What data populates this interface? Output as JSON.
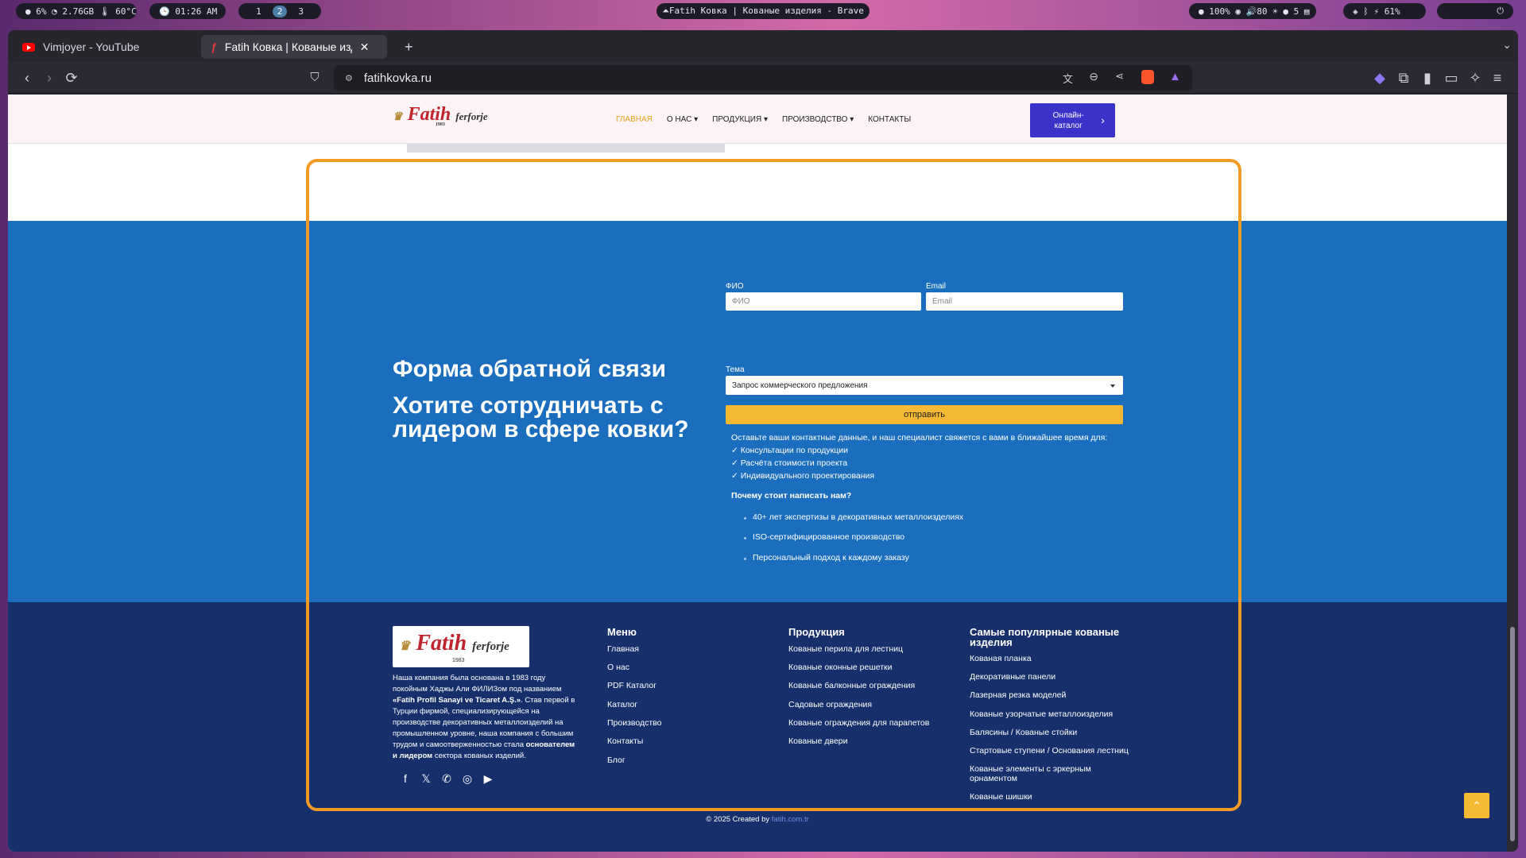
{
  "system_bar": {
    "stats": "● 6%  ◔ 2.76GB  🌡 60°C",
    "clock": "🕒  01:26 AM",
    "workspaces": [
      "1",
      "2",
      "3"
    ],
    "active_workspace": "2",
    "window_title": "⏶Fatih Ковка | Кованые изделия - Brave",
    "status": "● 100%  ◉  🔊80  ☀  ● 5  ▤",
    "battery": "◈  ᛒ  ⚡ 61%",
    "tray": "⏻"
  },
  "browser": {
    "tabs": [
      {
        "label": "Vimjoyer - YouTube",
        "active": false
      },
      {
        "label": "Fatih Ковка | Кованые изд",
        "active": true
      }
    ],
    "new_tab": "+",
    "url": "fatihkovka.ru"
  },
  "header": {
    "logo_text": "Fatih",
    "logo_sub": "ferforje",
    "logo_year": "1983",
    "menu": [
      "ГЛАВНАЯ",
      "О НАС ▾",
      "ПРОДУКЦИЯ ▾",
      "ПРОИЗВОДСТВО ▾",
      "КОНТАКТЫ"
    ],
    "catalog_button": "Онлайн-\nкаталог",
    "catalog_arrow": "›"
  },
  "contact": {
    "title": "Форма обратной связи",
    "subtitle": "Хотите сотрудничать с лидером в сфере ковки?",
    "fio_label": "ФИО",
    "fio_placeholder": "ФИО",
    "email_label": "Email",
    "email_placeholder": "Email",
    "topic_label": "Тема",
    "topic_value": "Запрос коммерческого предложения",
    "submit": "отправить",
    "info": "Оставьте ваши контактные данные, и наш специалист свяжется с вами в ближайшее время для:",
    "checks": [
      "✓ Консультации по продукции",
      "✓ Расчёта стоимости проекта",
      "✓ Индивидуального проектирования"
    ],
    "why_title": "Почему стоит написать нам?",
    "bullets": [
      "40+ лет экспертизы в декоративных металлоизделиях",
      "ISO-сертифицированное производство",
      "Персональный подход к каждому заказу"
    ]
  },
  "footer": {
    "about_1": "Наша компания была основана в 1983 году покойным Хаджы Али ФИЛИЗом под названием ",
    "about_company": "«Fatih Profil Sanayi ve Ticaret A.Ş.»",
    "about_2": ". Став первой в Турции фирмой, специализирующейся на производстве декоративных металлоизделий на промышленном уровне, наша компания с большим трудом и самоотверженностью стала ",
    "about_bold": "основателем и лидером",
    "about_3": " сектора кованых изделий.",
    "menu_title": "Меню",
    "menu_items": [
      "Главная",
      "О нас",
      "PDF Каталог",
      "Каталог",
      "Производство",
      "Контакты",
      "Блог"
    ],
    "products_title": "Продукция",
    "products_items": [
      "Кованые перила для лестниц",
      "Кованые оконные решетки",
      "Кованые балконные ограждения",
      "Садовые ограждения",
      "Кованые ограждения для парапетов",
      "Кованые двери"
    ],
    "popular_title": "Самые популярные кованые изделия",
    "popular_items": [
      "Кованая планка",
      "Декоративные панели",
      "Лазерная резка моделей",
      "Кованые узорчатые металлоизделия",
      "Балясины / Кованые стойки",
      "Стартовые ступени / Основания лестниц",
      "Кованые элементы с эркерным орнаментом",
      "Кованые шишки"
    ],
    "copyright": "© 2025 Created by ",
    "copyright_link": "fatih.com.tr",
    "to_top": "⌃"
  },
  "colors": {
    "accent_orange": "#f29a26",
    "contact_blue": "#1a6ebd",
    "footer_navy": "#172f6b",
    "submit_yellow": "#f5b933",
    "catalog_purple": "#3a33c9"
  }
}
